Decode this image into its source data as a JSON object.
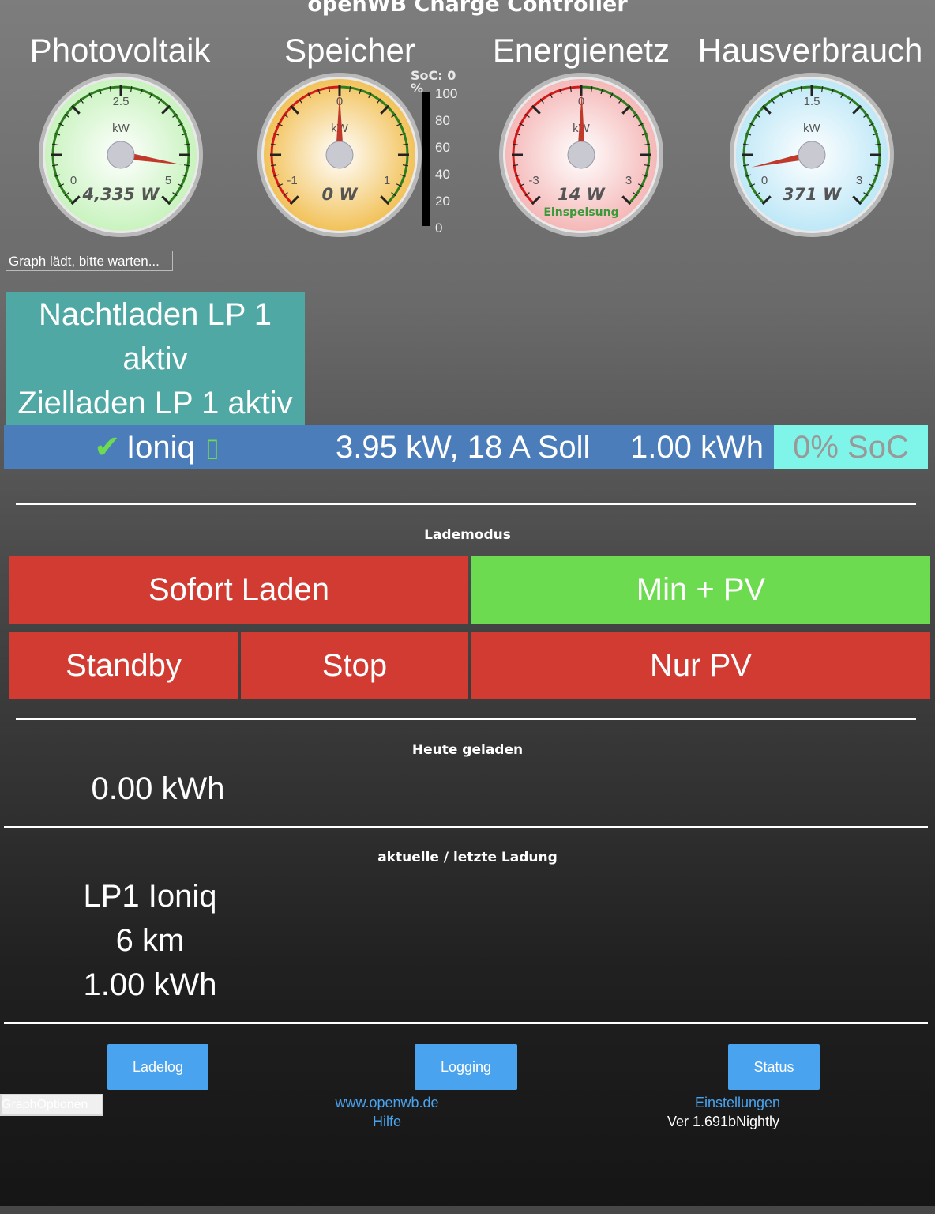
{
  "app_title": "openWB Charge Controller",
  "colors": {
    "teal_box": "#4fa8a4",
    "lp_bar": "#4a7dba",
    "soc_badge": "#7ff5ea",
    "active_mode": "#6ddb4f",
    "inactive_mode": "#d13b32",
    "footer_button": "#4aa3ef"
  },
  "gauges": [
    {
      "title": "Photovoltaik",
      "unit": "kW",
      "min_label": "0",
      "mid_label": "2.5",
      "max_label": "5",
      "value": "4,335 W",
      "sub_label": "",
      "face_color": "#c9f3bf",
      "value_fraction": 0.867
    },
    {
      "title": "Speicher",
      "unit": "kW",
      "min_label": "-1",
      "mid_label": "0",
      "max_label": "1",
      "value": "0 W",
      "sub_label": "",
      "face_color": "#f2c25a",
      "value_fraction": 0.5
    },
    {
      "title": "Energienetz",
      "unit": "kW",
      "min_label": "-3",
      "mid_label": "0",
      "max_label": "3",
      "value": "14 W",
      "sub_label": "Einspeisung",
      "face_color": "#f5b8b8",
      "value_fraction": 0.502
    },
    {
      "title": "Hausverbrauch",
      "unit": "kW",
      "min_label": "0",
      "mid_label": "1.5",
      "max_label": "3",
      "value": "371 W",
      "sub_label": "",
      "face_color": "#bfe8f7",
      "value_fraction": 0.124
    }
  ],
  "storage_soc": {
    "label": "SoC: 0 %",
    "ticks": [
      "100",
      "80",
      "60",
      "40",
      "20",
      "0"
    ]
  },
  "graph_loading": "Graph lädt, bitte warten...",
  "night_box": {
    "line1": "Nachtladen LP 1",
    "line2": "aktiv",
    "line3": "Zielladen LP 1 aktiv"
  },
  "lp": {
    "check_icon": "✔",
    "name": "Ioniq",
    "plug_icon": "▯",
    "power": "3.95 kW, 18 A Soll",
    "energy": "1.00 kWh",
    "soc": "0% SoC"
  },
  "lademodus": {
    "label": "Lademodus",
    "sofort": "Sofort Laden",
    "minpv": "Min + PV",
    "standby": "Standby",
    "stop": "Stop",
    "nurpv": "Nur PV"
  },
  "heute": {
    "label": "Heute geladen",
    "value": "0.00 kWh"
  },
  "ladung": {
    "label": "aktuelle / letzte Ladung",
    "line1": "LP1 Ioniq",
    "line2": "6 km",
    "line3": "1.00 kWh"
  },
  "footer": {
    "ladelog": "Ladelog",
    "logging": "Logging",
    "status": "Status",
    "graph_options": "GraphOptionen",
    "website": "www.openwb.de",
    "hilfe": "Hilfe",
    "einstellungen": "Einstellungen",
    "version": "Ver 1.691bNightly"
  }
}
